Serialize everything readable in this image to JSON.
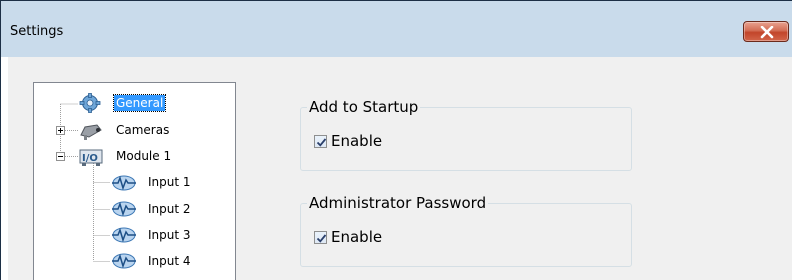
{
  "window": {
    "title": "Settings",
    "close_label": "×"
  },
  "tree": {
    "items": [
      {
        "label": "General",
        "icon": "gear-icon",
        "selected": true
      },
      {
        "label": "Cameras",
        "icon": "camera-icon",
        "expander": "plus"
      },
      {
        "label": "Module 1",
        "icon": "module-icon",
        "expander": "minus"
      },
      {
        "label": "Input 1",
        "icon": "signal-icon"
      },
      {
        "label": "Input 2",
        "icon": "signal-icon"
      },
      {
        "label": "Input 3",
        "icon": "signal-icon"
      },
      {
        "label": "Input 4",
        "icon": "signal-icon"
      }
    ]
  },
  "groups": {
    "startup": {
      "title": "Add to Startup",
      "checkbox_label": "Enable",
      "checked": true
    },
    "password": {
      "title": "Administrator Password",
      "checkbox_label": "Enable",
      "checked": true
    }
  },
  "colors": {
    "titlebar": "#c9dbeb",
    "client": "#f0f0f0",
    "selection": "#3399ff",
    "close_button": "#c2452a"
  }
}
